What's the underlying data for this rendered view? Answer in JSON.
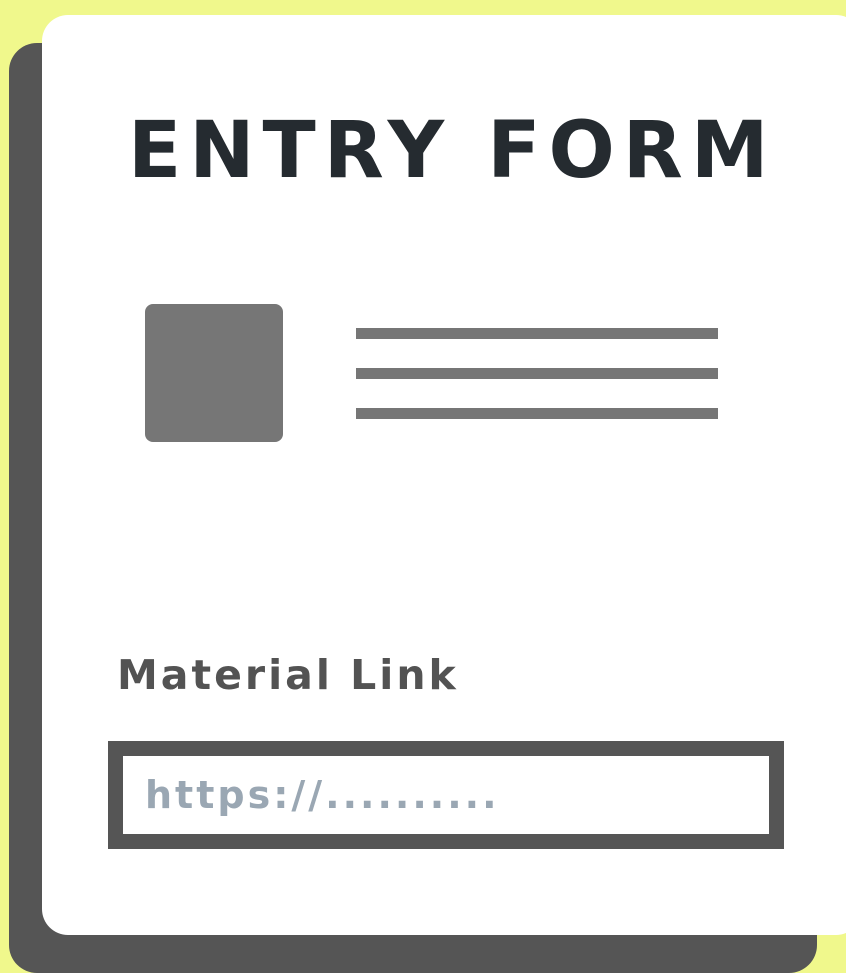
{
  "colors": {
    "background": "#f0f88c",
    "card": "#ffffff",
    "shadow": "#555555",
    "title_text": "#252b30",
    "placeholder_block": "#767676",
    "label_text": "#535353",
    "input_border": "#555555",
    "input_placeholder": "#9aa7b3"
  },
  "form": {
    "title": "ENTRY FORM",
    "material_link": {
      "label": "Material Link",
      "value": "",
      "placeholder": "https://.........."
    }
  },
  "icons": {
    "image_placeholder": "image-placeholder-icon",
    "text_lines": "text-lines-icon"
  }
}
